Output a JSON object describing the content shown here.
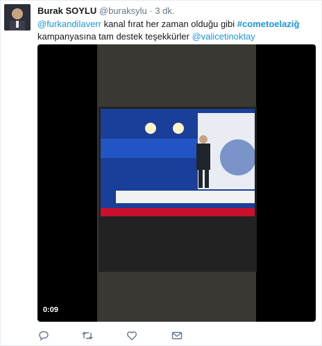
{
  "author": {
    "name": "Burak SOYLU",
    "handle": "@buraksylu",
    "separator": "·",
    "time": "3 dk."
  },
  "tweet": {
    "mention1": "@furkandilaverr",
    "text1": " kanal fırat her zaman olduğu gibi ",
    "hashtag": "#cometoelaziğ",
    "text2": " kampanyasına tam destek teşekkürler ",
    "mention2": "@valicetinoktay"
  },
  "video": {
    "timecode": "0:09"
  },
  "actions": [
    {
      "icon": "reply-icon"
    },
    {
      "icon": "retweet-icon"
    },
    {
      "icon": "like-icon"
    },
    {
      "icon": "message-icon"
    }
  ]
}
